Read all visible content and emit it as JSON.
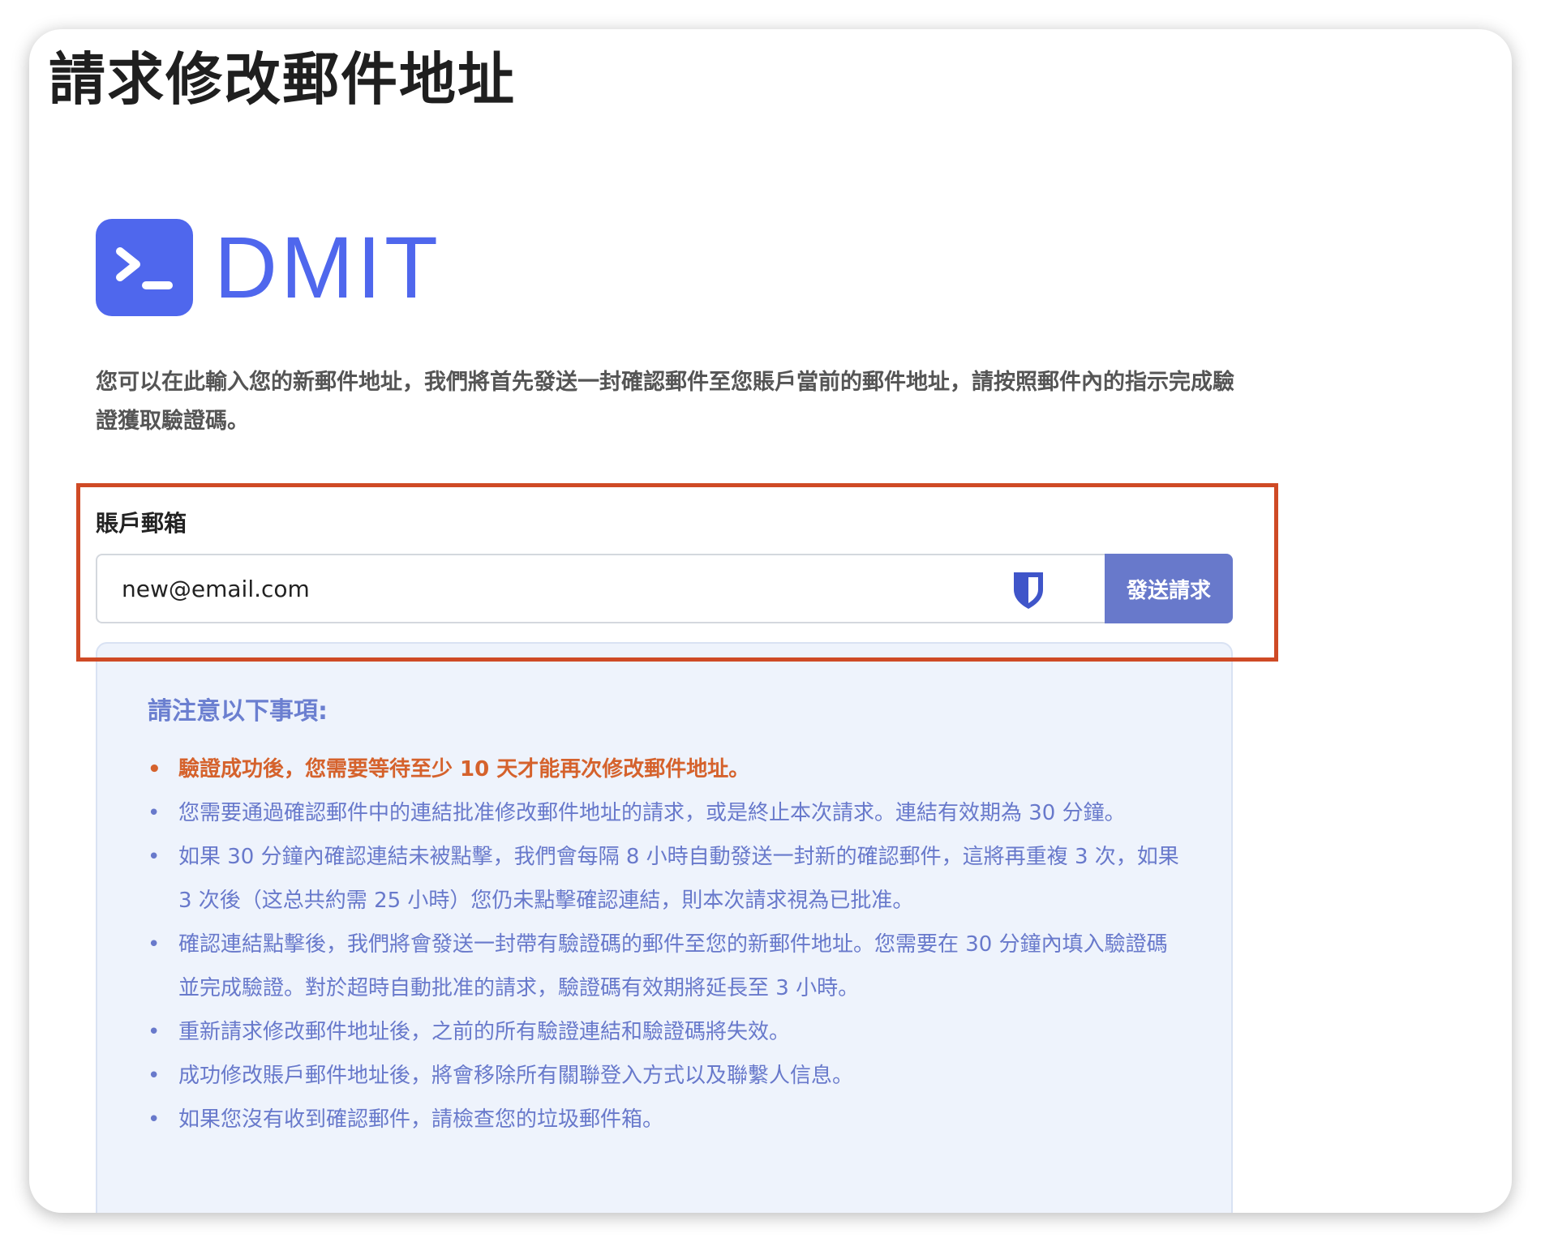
{
  "page": {
    "title": "請求修改郵件地址"
  },
  "brand": {
    "name": "DMIT",
    "color": "#4f67ed",
    "icon": "terminal-prompt-icon"
  },
  "intro": {
    "text": "您可以在此輸入您的新郵件地址，我們將首先發送一封確認郵件至您賬戶當前的郵件地址，請按照郵件內的指示完成驗證獲取驗證碼。"
  },
  "form": {
    "label": "賬戶郵箱",
    "email_value": "new@email.com",
    "password_manager_icon": "shield-icon",
    "submit_label": "發送請求",
    "button_color": "#6879cb",
    "highlight_color": "#cf4a25"
  },
  "notice": {
    "title": "請注意以下事項:",
    "items": [
      {
        "text": "驗證成功後，您需要等待至少 10 天才能再次修改郵件地址。",
        "warn": true
      },
      {
        "text": "您需要通過確認郵件中的連結批准修改郵件地址的請求，或是終止本次請求。連結有效期為 30 分鐘。",
        "warn": false
      },
      {
        "text": "如果 30 分鐘內確認連結未被點擊，我們會每隔 8 小時自動發送一封新的確認郵件，這將再重複 3 次，如果 3 次後（这总共約需 25 小時）您仍未點擊確認連結，則本次請求視為已批准。",
        "warn": false
      },
      {
        "text": "確認連結點擊後，我們將會發送一封帶有驗證碼的郵件至您的新郵件地址。您需要在 30 分鐘內填入驗證碼並完成驗證。對於超時自動批准的請求，驗證碼有效期將延長至 3 小時。",
        "warn": false
      },
      {
        "text": "重新請求修改郵件地址後，之前的所有驗證連結和驗證碼將失效。",
        "warn": false
      },
      {
        "text": "成功修改賬戶郵件地址後，將會移除所有關聯登入方式以及聯繫人信息。",
        "warn": false
      },
      {
        "text": "如果您沒有收到確認郵件，請檢查您的垃圾郵件箱。",
        "warn": false
      }
    ],
    "text_color": "#6879cb",
    "warn_color": "#d5622c"
  }
}
